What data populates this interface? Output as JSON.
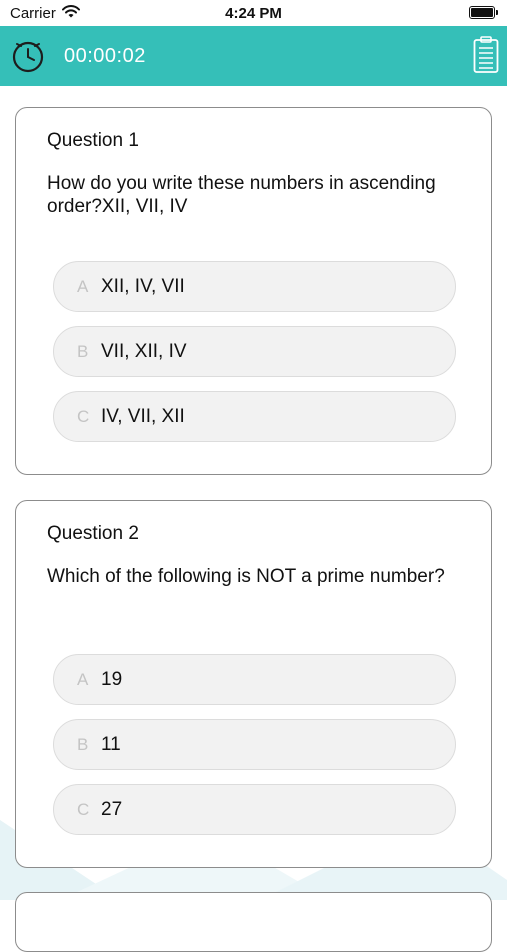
{
  "status_bar": {
    "carrier": "Carrier",
    "time": "4:24 PM"
  },
  "header": {
    "timer": "00:00:02",
    "color": "#35bfb8"
  },
  "questions": [
    {
      "title": "Question 1",
      "text": "How do you write these numbers in ascending order?XII, VII, IV",
      "options": [
        {
          "letter": "A",
          "text": "XII, IV, VII"
        },
        {
          "letter": "B",
          "text": "VII, XII, IV"
        },
        {
          "letter": "C",
          "text": "IV, VII, XII"
        }
      ]
    },
    {
      "title": "Question 2",
      "text": "Which of the following is NOT a prime number?",
      "options": [
        {
          "letter": "A",
          "text": "19"
        },
        {
          "letter": "B",
          "text": "11"
        },
        {
          "letter": "C",
          "text": "27"
        }
      ]
    }
  ]
}
